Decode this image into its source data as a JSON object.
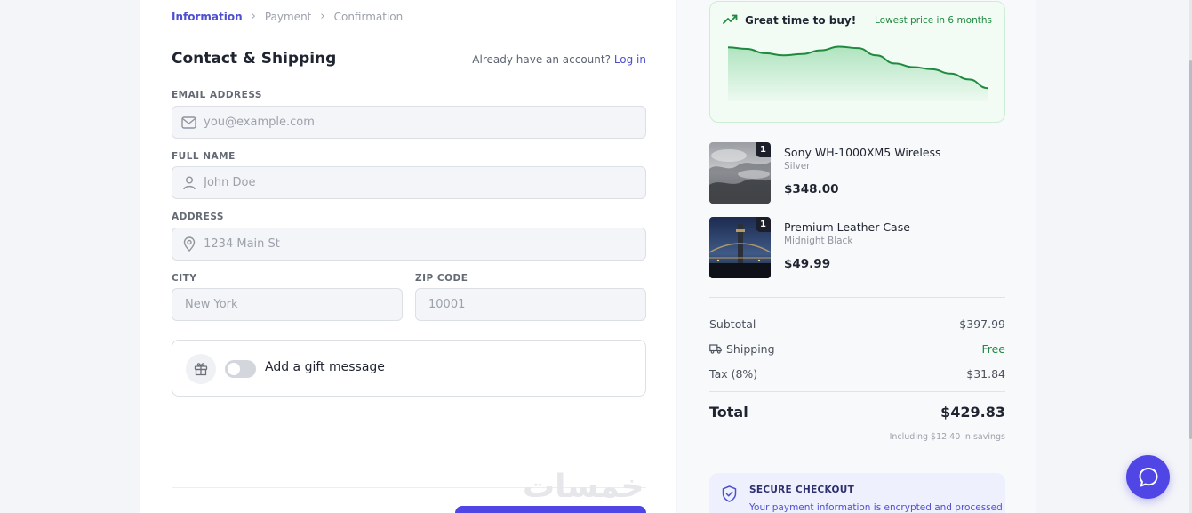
{
  "breadcrumb": {
    "items": [
      "Information",
      "Payment",
      "Confirmation"
    ],
    "separator": "›"
  },
  "contact": {
    "title": "Contact & Shipping",
    "account_prompt": "Already have an account?",
    "login_link": "Log in"
  },
  "form": {
    "email": {
      "label": "EMAIL ADDRESS",
      "placeholder": "you@example.com",
      "value": "",
      "icon": "mail-icon"
    },
    "full_name": {
      "label": "FULL NAME",
      "placeholder": "John Doe",
      "value": "",
      "icon": "user-icon"
    },
    "address": {
      "label": "ADDRESS",
      "placeholder": "1234 Main St",
      "value": "",
      "icon": "map-pin-icon"
    },
    "city": {
      "label": "CITY",
      "placeholder": "New York",
      "value": ""
    },
    "zip": {
      "label": "ZIP CODE",
      "placeholder": "10001",
      "value": ""
    }
  },
  "gift": {
    "label": "Add a gift message",
    "enabled": false,
    "icon": "gift-icon"
  },
  "price_insight": {
    "headline": "Great time to buy!",
    "note": "Lowest price in 6 months",
    "icon": "trending-icon",
    "trend_values": [
      0.74,
      0.72,
      0.66,
      0.63,
      0.65,
      0.7,
      0.75,
      0.73,
      0.63,
      0.52,
      0.47,
      0.44,
      0.38,
      0.3,
      0.18
    ],
    "color": "#1f8a3f"
  },
  "cart": {
    "items": [
      {
        "name": "Sony WH-1000XM5 Wireless",
        "variant": "Silver",
        "price": "$348.00",
        "qty": "1"
      },
      {
        "name": "Premium Leather Case",
        "variant": "Midnight Black",
        "price": "$49.99",
        "qty": "1"
      }
    ]
  },
  "summary": {
    "subtotal_label": "Subtotal",
    "subtotal": "$397.99",
    "shipping_label": "Shipping",
    "shipping": "Free",
    "tax_label": "Tax (8%)",
    "tax": "$31.84",
    "total_label": "Total",
    "total": "$429.83",
    "savings": "Including $12.40 in savings"
  },
  "secure": {
    "title": "SECURE CHECKOUT",
    "text": "Your payment information is encrypted and processed"
  },
  "colors": {
    "accent": "#4f46e5",
    "success": "#1f8a3f"
  },
  "watermark": "خمسات"
}
